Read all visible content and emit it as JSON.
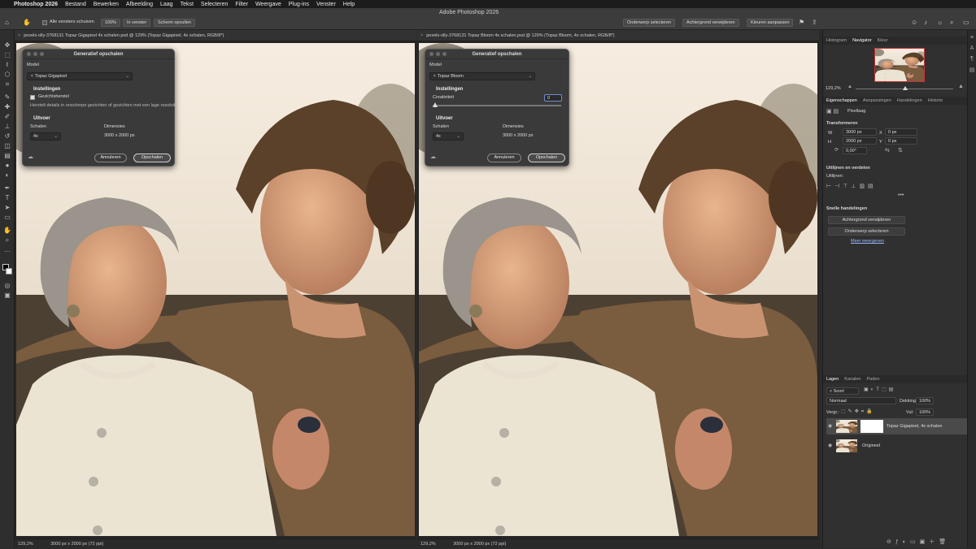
{
  "menubar": {
    "app": "Photoshop 2026",
    "items": [
      "Bestand",
      "Bewerken",
      "Afbeelding",
      "Laag",
      "Tekst",
      "Selecteren",
      "Filter",
      "Weergave",
      "Plug-ins",
      "Venster",
      "Help"
    ]
  },
  "optionsbar": {
    "title": "Adobe Photoshop 2026",
    "scroll_all": "Alle vensters schuiven",
    "zoom": "100%",
    "fit_window": "In venster",
    "fill_screen": "Scherm opvullen",
    "select_subject": "Onderwerp selecteren",
    "remove_bg": "Achtergrond verwijderen",
    "adjust_colors": "Kleuren aanpassen"
  },
  "left_doc": {
    "tab": "pexels-olly-3768131 Topaz Gigapixel 4x schalen.psd @ 129% (Topaz Gigapixel, 4x schalen, RGB/8*)",
    "zoom": "129,2%",
    "dims": "3000 px x 2000 px (72 ppi)",
    "dialog": {
      "title": "Generatief opschalen",
      "model_label": "Model",
      "model_value": "Topaz Gigapixel",
      "settings_heading": "Instellingen",
      "face_label": "Gezichtsherstel",
      "face_desc": "Herstelt details in onscherpe gezichten of gezichten met een lage resolutie",
      "output_heading": "Uitvoer",
      "scale_label": "Schalen",
      "dims_label": "Dimensies",
      "scale_value": "4x",
      "dims_value": "3000 x 2000 px",
      "cancel": "Annuleren",
      "ok": "Opschalen"
    }
  },
  "right_doc": {
    "tab": "pexels-olly-3768131 Topaz Bloom 4x schalen.psd @ 129% (Topaz Bloom, 4x schalen, RGB/8*)",
    "zoom": "129,2%",
    "dims": "3000 px x 2000 px (72 ppi)",
    "dialog": {
      "title": "Generatief opschalen",
      "model_label": "Model",
      "model_value": "Topaz Bloom",
      "settings_heading": "Instellingen",
      "creativity_label": "Creativiteit",
      "creativity_value": "0",
      "output_heading": "Uitvoer",
      "scale_label": "Schalen",
      "dims_label": "Dimensies",
      "scale_value": "4x",
      "dims_value": "3000 x 2000 px",
      "cancel": "Annuleren",
      "ok": "Opschalen"
    }
  },
  "panels": {
    "top_tabs": [
      "Histogram",
      "Navigator",
      "Kleur"
    ],
    "nav_zoom": "129,2%",
    "props_tabs": [
      "Eigenschappen",
      "Aanpassingen",
      "Handelingen",
      "Historie"
    ],
    "layer_type": "Pixellaag",
    "transform": "Transformeren",
    "w": "3000 px",
    "h": "2000 px",
    "x": "0 px",
    "y": "0 px",
    "angle": "0,00°",
    "align_heading": "Uitlijnen en verdelen",
    "align_label": "Uitlijnen:",
    "quick_heading": "Snelle handelingen",
    "quick_remove_bg": "Achtergrond verwijderen",
    "quick_select": "Onderwerp selecteren",
    "more": "Meer weergeven",
    "layers_tabs": [
      "Lagen",
      "Kanalen",
      "Paden"
    ],
    "search": "Soort",
    "blend": "Normaal",
    "opacity_label": "Dekking:",
    "opacity": "100%",
    "lock_label": "Vergr.:",
    "fill_label": "Vul:",
    "fill": "100%",
    "layers": [
      {
        "name": "Topaz Gigapixel, 4x schalen"
      },
      {
        "name": "Origineel"
      }
    ]
  }
}
